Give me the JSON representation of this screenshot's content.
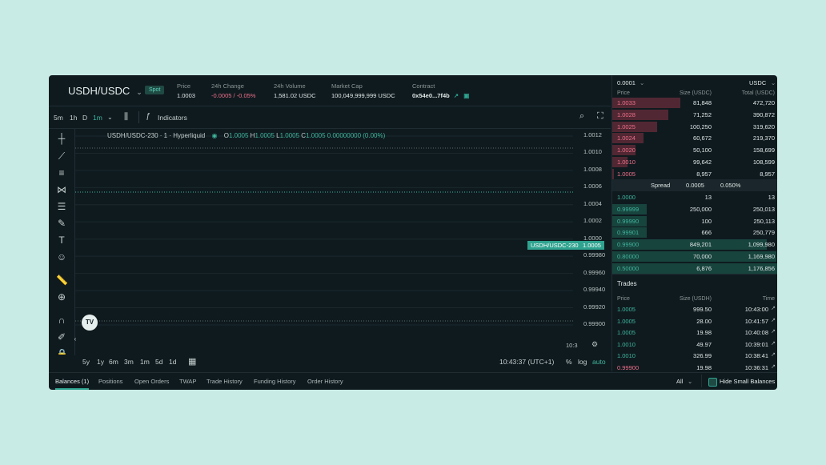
{
  "header": {
    "pair": "USDH/USDC",
    "badge": "Spot",
    "stats": [
      {
        "label": "Price",
        "value": "1.0003"
      },
      {
        "label": "24h Change",
        "value": "-0.0005 / -0.05%"
      },
      {
        "label": "24h Volume",
        "value": "1,581.02 USDC"
      },
      {
        "label": "Market Cap",
        "value": "100,049,999,999 USDC"
      },
      {
        "label": "Contract",
        "value": "0x54e0...7f4b"
      }
    ]
  },
  "toolbar": {
    "intervals": [
      "5m",
      "1h",
      "D",
      "1m"
    ],
    "indicators_label": "Indicators"
  },
  "chart": {
    "legend_symbol": "USDH/USDC-230 · 1 · Hyperliquid",
    "ohlc": {
      "o": "1.0005",
      "h": "1.0005",
      "l": "1.0005",
      "c": "1.0005",
      "change": "0.00000000 (0.00%)"
    },
    "price_tag": "1.0005",
    "pair_tag": "USDH/USDC-230",
    "y_ticks": [
      "1.0012",
      "1.0010",
      "1.0008",
      "1.0006",
      "1.0004",
      "1.0002",
      "1.0000",
      "0.99980",
      "0.99960",
      "0.99940",
      "0.99920",
      "0.99900"
    ],
    "time_axis_partial": "10:3"
  },
  "bottom_toolbar": {
    "ranges": [
      "5y",
      "1y",
      "6m",
      "3m",
      "1m",
      "5d",
      "1d"
    ],
    "clock": "10:43:37 (UTC+1)",
    "pct": "%",
    "log": "log",
    "auto": "auto"
  },
  "tabs": [
    "Balances (1)",
    "Positions",
    "Open Orders",
    "TWAP",
    "Trade History",
    "Funding History",
    "Order History"
  ],
  "tabs_right": {
    "filter": "All",
    "hide_small": "Hide Small Balances"
  },
  "orderbook": {
    "tick_size": "0.0001",
    "quote": "USDC",
    "columns": [
      "Price",
      "Size (USDC)",
      "Total (USDC)"
    ],
    "asks": [
      {
        "price": "1.0033",
        "size": "81,848",
        "total": "472,720",
        "depth": 0.41
      },
      {
        "price": "1.0028",
        "size": "71,252",
        "total": "390,872",
        "depth": 0.34
      },
      {
        "price": "1.0025",
        "size": "100,250",
        "total": "319,620",
        "depth": 0.27
      },
      {
        "price": "1.0024",
        "size": "60,672",
        "total": "219,370",
        "depth": 0.19
      },
      {
        "price": "1.0020",
        "size": "50,100",
        "total": "158,699",
        "depth": 0.14
      },
      {
        "price": "1.0010",
        "size": "99,642",
        "total": "108,599",
        "depth": 0.09
      },
      {
        "price": "1.0005",
        "size": "8,957",
        "total": "8,957",
        "depth": 0.01
      }
    ],
    "spread": {
      "label": "Spread",
      "value": "0.0005",
      "pct": "0.050%"
    },
    "bids": [
      {
        "price": "1.0000",
        "size": "13",
        "total": "13",
        "depth": 0.0
      },
      {
        "price": "0.99999",
        "size": "250,000",
        "total": "250,013",
        "depth": 0.21
      },
      {
        "price": "0.99990",
        "size": "100",
        "total": "250,113",
        "depth": 0.21
      },
      {
        "price": "0.99901",
        "size": "666",
        "total": "250,779",
        "depth": 0.21
      },
      {
        "price": "0.99900",
        "size": "849,201",
        "total": "1,099,980",
        "depth": 0.93
      },
      {
        "price": "0.80000",
        "size": "70,000",
        "total": "1,169,980",
        "depth": 0.99
      },
      {
        "price": "0.50000",
        "size": "6,876",
        "total": "1,176,856",
        "depth": 1.0
      }
    ]
  },
  "trades": {
    "title": "Trades",
    "columns": [
      "Price",
      "Size (USDH)",
      "Time"
    ],
    "rows": [
      {
        "price": "1.0005",
        "size": "999.50",
        "time": "10:43:00",
        "side": "buy"
      },
      {
        "price": "1.0005",
        "size": "28.00",
        "time": "10:41:57",
        "side": "buy"
      },
      {
        "price": "1.0005",
        "size": "19.98",
        "time": "10:40:08",
        "side": "buy"
      },
      {
        "price": "1.0010",
        "size": "49.97",
        "time": "10:39:01",
        "side": "buy"
      },
      {
        "price": "1.0010",
        "size": "326.99",
        "time": "10:38:41",
        "side": "buy"
      },
      {
        "price": "0.99900",
        "size": "19.98",
        "time": "10:36:31",
        "side": "sell"
      }
    ]
  },
  "colors": {
    "accent": "#2fa38f",
    "ask": "#ed7088",
    "bid": "#3fb59c",
    "bg": "#0f1a1f"
  }
}
